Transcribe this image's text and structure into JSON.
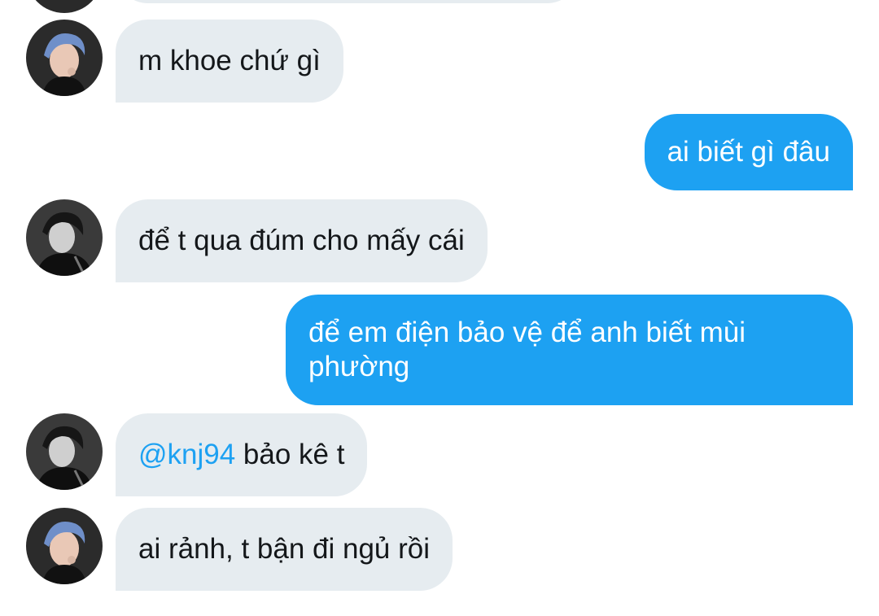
{
  "messages": [
    {
      "id": "m1",
      "direction": "incoming",
      "text": "m khoe chứ gì",
      "avatar": "avatar-color-blue-hair"
    },
    {
      "id": "m2",
      "direction": "outgoing",
      "text": "ai biết gì đâu"
    },
    {
      "id": "m3",
      "direction": "incoming",
      "text": "để t qua đúm cho mấy cái",
      "avatar": "avatar-monochrome"
    },
    {
      "id": "m4",
      "direction": "outgoing",
      "line1": "để em điện bảo vệ để anh biết mùi",
      "line2": "phường"
    },
    {
      "id": "m5",
      "direction": "incoming",
      "mention": "@knj94",
      "rest": " bảo kê t",
      "avatar": "avatar-monochrome"
    },
    {
      "id": "m6",
      "direction": "incoming",
      "text": "ai rảnh, t bận đi ngủ rồi",
      "avatar": "avatar-color-blue-hair"
    }
  ],
  "colors": {
    "incoming_bubble": "#e6ecf0",
    "outgoing_bubble": "#1da1f2",
    "mention": "#1da1f2",
    "text": "#14171a"
  }
}
